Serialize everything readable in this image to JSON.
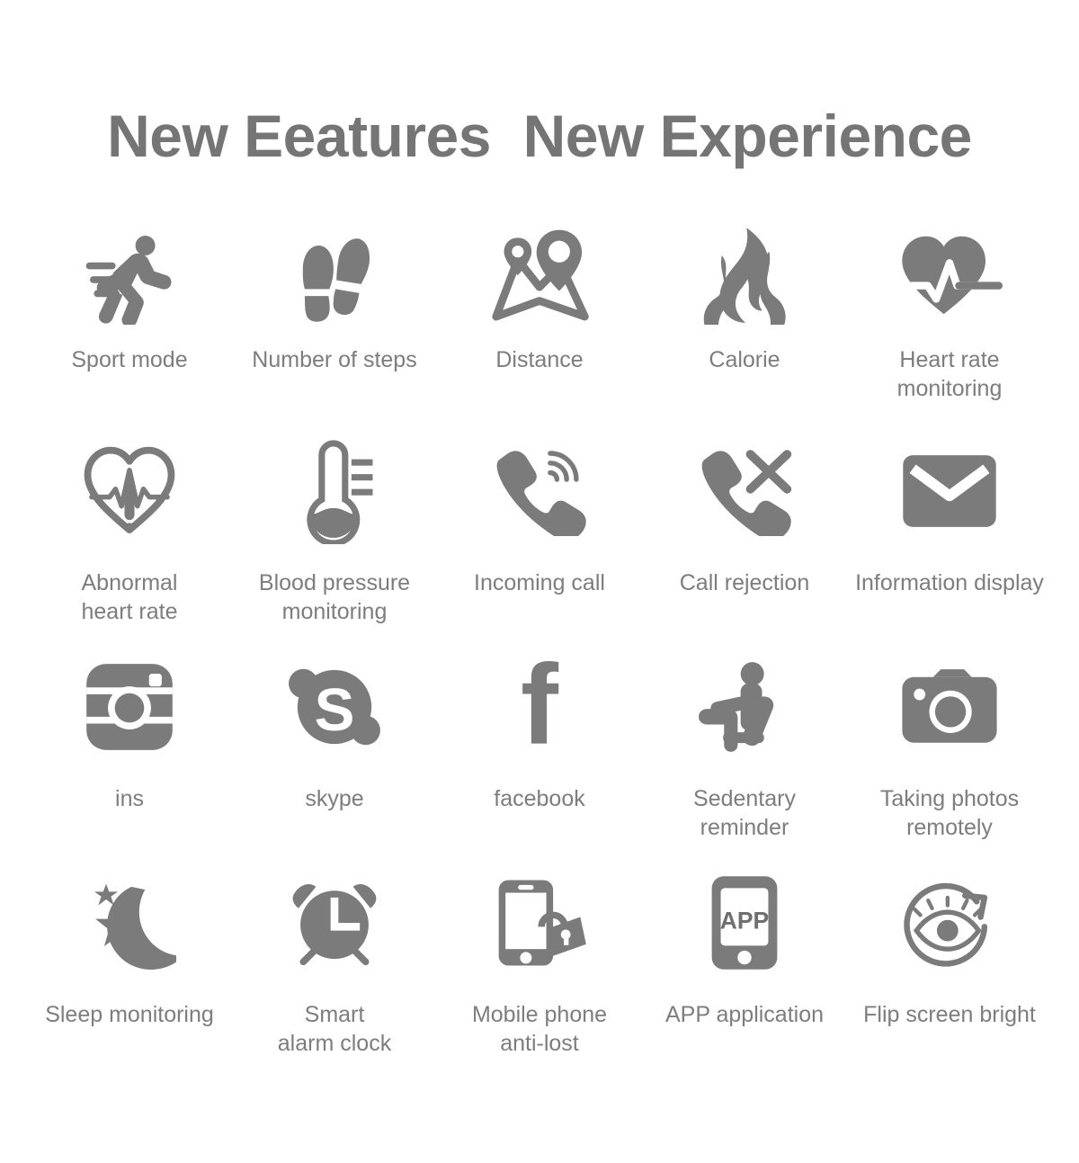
{
  "header": {
    "title": "New Eeatures  New Experience"
  },
  "features": [
    {
      "id": "sport-mode",
      "icon": "running-man-icon",
      "label": "Sport mode"
    },
    {
      "id": "number-of-steps",
      "icon": "footprints-icon",
      "label": "Number of steps"
    },
    {
      "id": "distance",
      "icon": "map-location-pins-icon",
      "label": "Distance"
    },
    {
      "id": "calorie",
      "icon": "flame-icon",
      "label": "Calorie"
    },
    {
      "id": "heart-rate-monitoring",
      "icon": "heart-pulse-filled-icon",
      "label": "Heart rate\nmonitoring"
    },
    {
      "id": "abnormal-heart-rate",
      "icon": "heart-pulse-alert-icon",
      "label": "Abnormal\nheart rate"
    },
    {
      "id": "blood-pressure-monitoring",
      "icon": "thermometer-icon",
      "label": "Blood pressure\nmonitoring"
    },
    {
      "id": "incoming-call",
      "icon": "phone-ringing-icon",
      "label": "Incoming call"
    },
    {
      "id": "call-rejection",
      "icon": "phone-reject-icon",
      "label": "Call rejection"
    },
    {
      "id": "information-display",
      "icon": "envelope-icon",
      "label": "Information display"
    },
    {
      "id": "ins",
      "icon": "instagram-icon",
      "label": "ins"
    },
    {
      "id": "skype",
      "icon": "skype-icon",
      "label": "skype"
    },
    {
      "id": "facebook",
      "icon": "facebook-icon",
      "label": "facebook"
    },
    {
      "id": "sedentary-reminder",
      "icon": "sitting-person-icon",
      "label": "Sedentary\nreminder"
    },
    {
      "id": "taking-photos-remotely",
      "icon": "camera-icon",
      "label": "Taking photos\nremotely"
    },
    {
      "id": "sleep-monitoring",
      "icon": "moon-stars-icon",
      "label": "Sleep monitoring"
    },
    {
      "id": "smart-alarm-clock",
      "icon": "alarm-clock-icon",
      "label": "Smart\nalarm clock"
    },
    {
      "id": "mobile-phone-anti-lost",
      "icon": "phone-lock-icon",
      "label": "Mobile phone\nanti-lost"
    },
    {
      "id": "app-application",
      "icon": "phone-app-icon",
      "label": "APP application"
    },
    {
      "id": "flip-screen-bright",
      "icon": "eye-rotate-icon",
      "label": "Flip screen bright"
    }
  ],
  "icon_text": {
    "app_screen_label": "APP",
    "skype_letter": "S",
    "facebook_letter": "f"
  },
  "colors": {
    "icon": "#7b7b7b",
    "title": "#757575",
    "caption": "#7d7d7d",
    "background": "#ffffff"
  }
}
